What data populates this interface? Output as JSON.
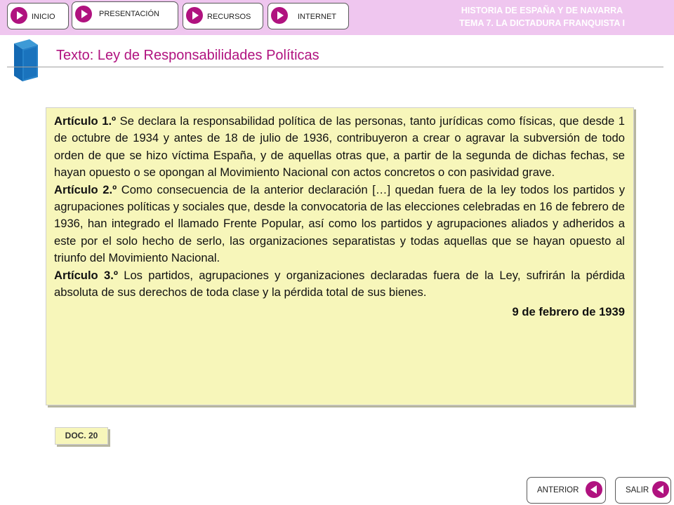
{
  "nav": {
    "inicio": "INICIO",
    "presentacion": "PRESENTACIÓN",
    "recursos": "RECURSOS",
    "internet": "INTERNET"
  },
  "course": {
    "line1": "HISTORIA DE ESPAÑA Y DE NAVARRA",
    "line2": "TEMA 7. LA DICTADURA FRANQUISTA I"
  },
  "page": {
    "title": "Texto: Ley de Responsabilidades  Políticas"
  },
  "document": {
    "articles": [
      {
        "label": "Artículo 1.º",
        "text": " Se declara la responsabilidad política de las personas, tanto jurídicas como físicas, que desde 1 de octubre de 1934 y antes de 18 de julio de 1936, contribuyeron a crear o agravar la subversión de todo orden de que se hizo víctima España, y de aquellas otras que, a partir de la segunda de dichas fechas, se hayan opuesto o se opongan al Movimiento Nacional con actos concretos o con pasividad grave."
      },
      {
        "label": "Artículo 2.º",
        "text": " Como consecuencia de la anterior declaración […] quedan fuera de la ley todos los partidos y agrupaciones políticas y sociales que, desde la convocatoria de las elecciones celebradas en 16 de febrero de 1936, han integrado el llamado Frente Popular, así como los partidos y agrupaciones aliados y adheridos a este por el solo hecho de serlo, las organizaciones separatistas y todas aquellas que se hayan opuesto al triunfo del Movimiento Nacional."
      },
      {
        "label": "Artículo 3.º",
        "text": " Los partidos, agrupaciones y organizaciones declaradas fuera de la Ley, sufrirán la pérdida absoluta de sus derechos de toda clase y la pérdida total de sus bienes."
      }
    ],
    "date": "9 de febrero de 1939",
    "badge": "DOC. 20"
  },
  "footer": {
    "anterior": "ANTERIOR",
    "salir": "SALIR"
  },
  "colors": {
    "accent": "#b0127f",
    "topbar": "#efc6ef",
    "paper": "#f7f6ba"
  },
  "icons": {
    "book": "book-icon",
    "forward": "play-arrow-icon",
    "back": "back-arrow-icon"
  }
}
